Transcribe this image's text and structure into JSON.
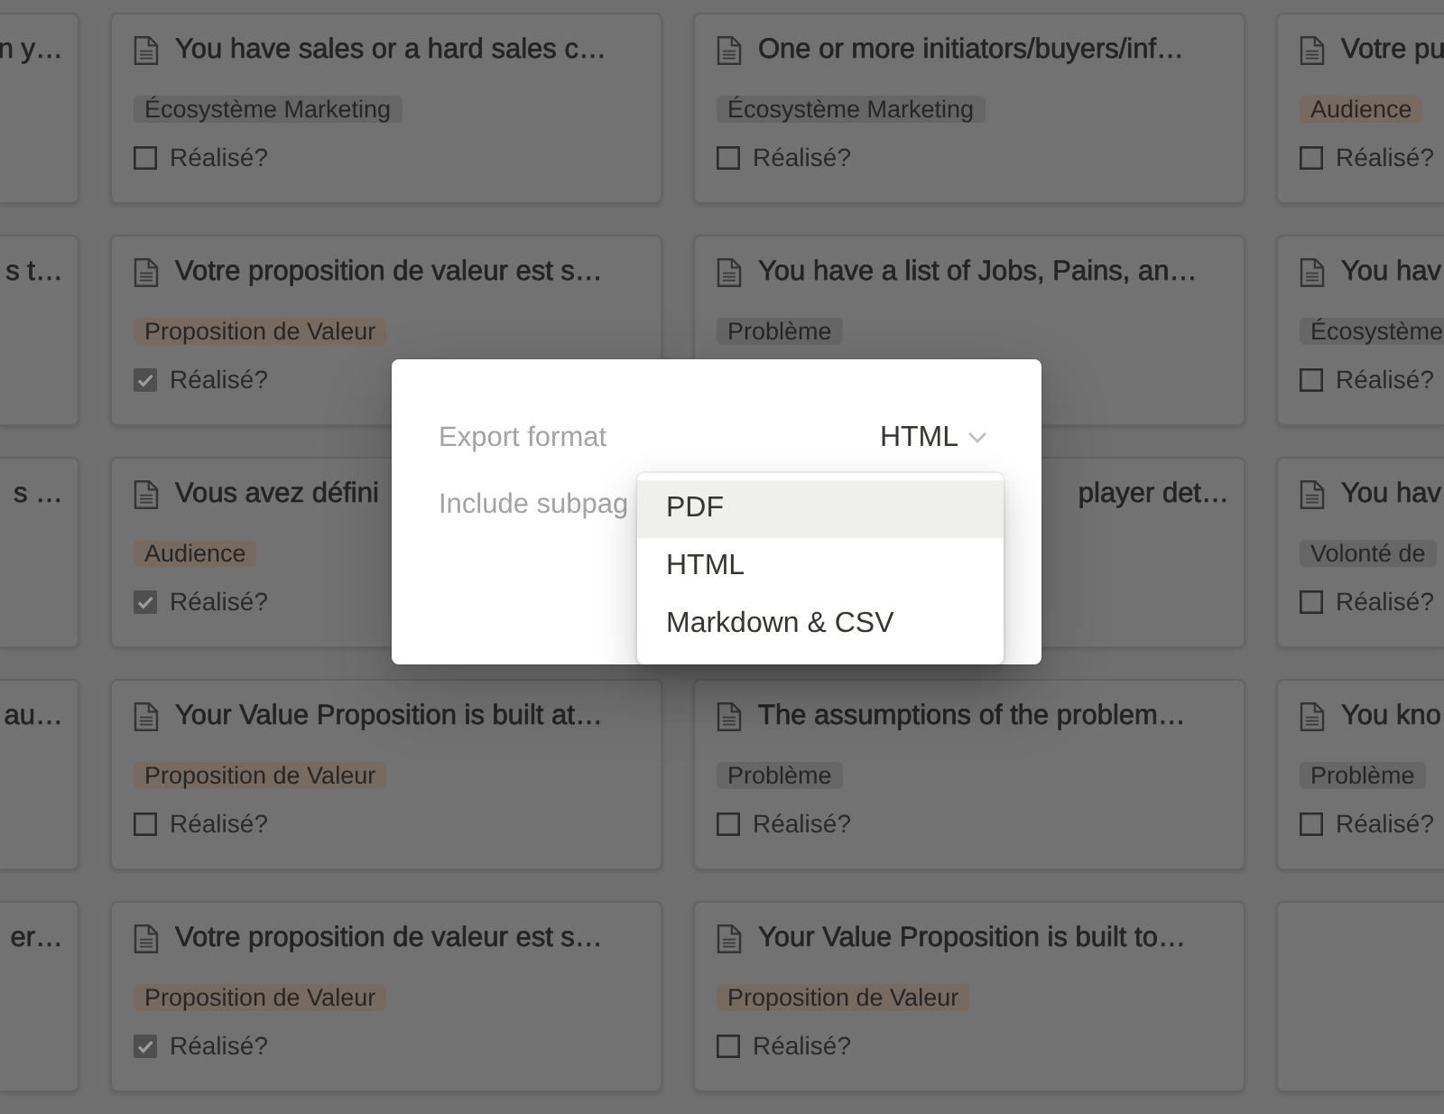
{
  "gallery": {
    "rows": [
      {
        "cards": [
          {
            "kind": "tail",
            "title": "n y…"
          },
          {
            "kind": "full",
            "title": "You have sales or a hard sales c…",
            "tag": {
              "label": "Écosystème Marketing",
              "color": "#666666"
            },
            "checkbox": {
              "label": "Réalisé?",
              "checked": false
            }
          },
          {
            "kind": "full",
            "title": "One or more initiators/buyers/inf…",
            "tag": {
              "label": "Écosystème Marketing",
              "color": "#666666"
            },
            "checkbox": {
              "label": "Réalisé?",
              "checked": false
            }
          },
          {
            "kind": "full",
            "title": "Votre pu",
            "tag": {
              "label": "Audience",
              "color": "#776a60"
            },
            "checkbox": {
              "label": "Réalisé?",
              "checked": false
            }
          }
        ]
      },
      {
        "cards": [
          {
            "kind": "tail",
            "title": "s t…"
          },
          {
            "kind": "full",
            "title": "Votre proposition de valeur est s…",
            "tag": {
              "label": "Proposition de Valeur",
              "color": "#776a60"
            },
            "checkbox": {
              "label": "Réalisé?",
              "checked": true
            }
          },
          {
            "kind": "full",
            "title": "You have a list of Jobs, Pains, an…",
            "tag": {
              "label": "Problème",
              "color": "#666666"
            }
          },
          {
            "kind": "full",
            "title": "You hav",
            "tag": {
              "label": "Écosystème",
              "color": "#666666"
            },
            "checkbox": {
              "label": "Réalisé?",
              "checked": false
            }
          }
        ]
      },
      {
        "cards": [
          {
            "kind": "tail",
            "title": "s …"
          },
          {
            "kind": "full",
            "title": "Vous avez défini",
            "tag": {
              "label": "Audience",
              "color": "#776a60"
            },
            "checkbox": {
              "label": "Réalisé?",
              "checked": true
            }
          },
          {
            "kind": "tail",
            "title": "player det…"
          },
          {
            "kind": "full",
            "title": "You hav",
            "tag": {
              "label": "Volonté de",
              "color": "#666666"
            },
            "checkbox": {
              "label": "Réalisé?",
              "checked": false
            }
          }
        ]
      },
      {
        "cards": [
          {
            "kind": "tail",
            "title": "au…"
          },
          {
            "kind": "full",
            "title": "Your Value Proposition is built at…",
            "tag": {
              "label": "Proposition de Valeur",
              "color": "#776a60"
            },
            "checkbox": {
              "label": "Réalisé?",
              "checked": false
            }
          },
          {
            "kind": "full",
            "title": "The assumptions of the problem…",
            "tag": {
              "label": "Problème",
              "color": "#666666"
            },
            "checkbox": {
              "label": "Réalisé?",
              "checked": false
            }
          },
          {
            "kind": "full",
            "title": "You kno",
            "tag": {
              "label": "Problème",
              "color": "#666666"
            },
            "checkbox": {
              "label": "Réalisé?",
              "checked": false
            }
          }
        ]
      },
      {
        "cards": [
          {
            "kind": "tail",
            "title": "er…"
          },
          {
            "kind": "full",
            "title": "Votre proposition de valeur est s…",
            "tag": {
              "label": "Proposition de Valeur",
              "color": "#776a60"
            },
            "checkbox": {
              "label": "Réalisé?",
              "checked": true
            }
          },
          {
            "kind": "full",
            "title": "Your Value Proposition is built to…",
            "tag": {
              "label": "Proposition de Valeur",
              "color": "#776a60"
            },
            "checkbox": {
              "label": "Réalisé?",
              "checked": false
            }
          },
          {
            "kind": "empty"
          }
        ]
      }
    ]
  },
  "export_dialog": {
    "rows": [
      {
        "label": "Export format",
        "value": "HTML"
      },
      {
        "label": "Include subpag"
      }
    ],
    "menu": {
      "options": [
        {
          "label": "PDF",
          "highlighted": true
        },
        {
          "label": "HTML",
          "highlighted": false
        },
        {
          "label": "Markdown & CSV",
          "highlighted": false
        }
      ]
    }
  }
}
